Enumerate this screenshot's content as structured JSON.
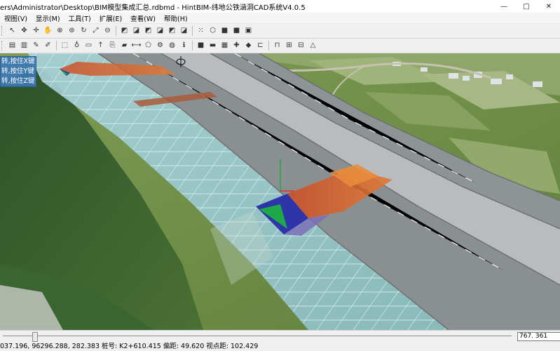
{
  "window": {
    "title": "ers\\Administrator\\Desktop\\BIM模型集成汇总.rdbmd - HintBIM-纬地公铁涵洞CAD系统V4.0.5",
    "controls": [
      "—",
      "□",
      "✕"
    ]
  },
  "menu": [
    "视图(V)",
    "显示(M)",
    "工具(T)",
    "扩展(E)",
    "查看(W)",
    "帮助(H)"
  ],
  "toolbar1": [
    {
      "name": "select-pointer-icon",
      "glyph": "↖"
    },
    {
      "name": "pan-move-icon",
      "glyph": "✥"
    },
    {
      "name": "crosshair-icon",
      "glyph": "✛"
    },
    {
      "name": "hand-pan-icon",
      "glyph": "✋"
    },
    {
      "name": "zoom-in-icon",
      "glyph": "⊕"
    },
    {
      "name": "zoom-window-icon",
      "glyph": "⊚"
    },
    {
      "name": "rotate-icon",
      "glyph": "↻"
    },
    {
      "name": "zoom-extents-icon",
      "glyph": "⤢"
    },
    {
      "name": "zoom-out-icon",
      "glyph": "⊖"
    },
    {
      "name": "view-front-icon",
      "glyph": "◩"
    },
    {
      "name": "view-back-icon",
      "glyph": "◪"
    },
    {
      "name": "view-left-icon",
      "glyph": "◩"
    },
    {
      "name": "view-right-icon",
      "glyph": "◪"
    },
    {
      "name": "view-top-icon",
      "glyph": "◩"
    },
    {
      "name": "view-bottom-icon",
      "glyph": "◪"
    },
    {
      "name": "point-cloud-icon",
      "glyph": "⁙"
    },
    {
      "name": "wireframe-cube-icon",
      "glyph": "⬡"
    },
    {
      "name": "shaded-cube-icon",
      "glyph": "■"
    },
    {
      "name": "textured-cube-icon",
      "glyph": "■"
    },
    {
      "name": "render-icon",
      "glyph": "▣"
    }
  ],
  "toolbar2": [
    {
      "name": "layer-1-icon",
      "glyph": "▤"
    },
    {
      "name": "layer-2-icon",
      "glyph": "▥"
    },
    {
      "name": "edit-icon",
      "glyph": "✎"
    },
    {
      "name": "pencil-icon",
      "glyph": "✐"
    },
    {
      "name": "cube-outline-icon",
      "glyph": "⬚"
    },
    {
      "name": "light-bulb-icon",
      "glyph": "♁"
    },
    {
      "name": "document-icon",
      "glyph": "▭"
    },
    {
      "name": "up-arrow-icon",
      "glyph": "↑"
    },
    {
      "name": "clip-icon",
      "glyph": "⎘"
    },
    {
      "name": "folder-icon",
      "glyph": "▰"
    },
    {
      "name": "dimension-icon",
      "glyph": "⟷"
    },
    {
      "name": "polygon-icon",
      "glyph": "⬠"
    },
    {
      "name": "settings-icon",
      "glyph": "⚙"
    },
    {
      "name": "globe-icon",
      "glyph": "◍"
    },
    {
      "name": "info-icon",
      "glyph": "ℹ"
    },
    {
      "name": "model-green-icon",
      "glyph": "■"
    },
    {
      "name": "flag-icon",
      "glyph": "▬"
    },
    {
      "name": "grid-icon",
      "glyph": "▦"
    },
    {
      "name": "cross-section-icon",
      "glyph": "✚"
    },
    {
      "name": "marker-icon",
      "glyph": "◆"
    },
    {
      "name": "frame-icon",
      "glyph": "⊏"
    },
    {
      "name": "tunnel-icon",
      "glyph": "⊓"
    },
    {
      "name": "bridge-icon",
      "glyph": "⊞"
    },
    {
      "name": "bridge-deck-icon",
      "glyph": "⊟"
    },
    {
      "name": "warning-icon",
      "glyph": "△"
    }
  ],
  "rotation_hints": [
    "转,按住X键",
    "转,按住Y键",
    "转,按住Z键"
  ],
  "coord_box": "767. 361",
  "status_line": "037.196, 96296.288, 282.383    桩号: K2+610.415    偏距: 49.620    视点距: 102.429",
  "colors": {
    "road_asphalt": "#8a8f92",
    "embankment_slope": "#9bc7cf",
    "culvert_orange": "#d9632a",
    "culvert_blue": "#2e35a8",
    "culvert_green": "#1fa84a",
    "terrain_green": "#6f8f48",
    "forest_dark": "#2f5a2c",
    "rotation_panel": "#3c78b4"
  }
}
